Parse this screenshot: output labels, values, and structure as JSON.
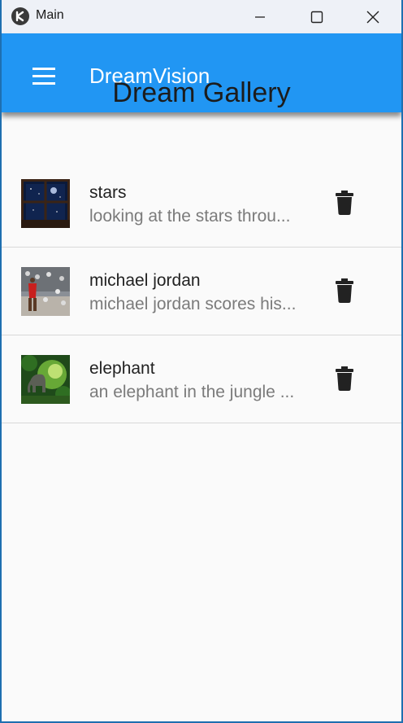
{
  "window": {
    "title": "Main",
    "icons": {
      "app": "kivy-logo-icon",
      "minimize": "minimize-icon",
      "maximize": "maximize-icon",
      "close": "close-icon"
    }
  },
  "appbar": {
    "menu_icon": "hamburger-menu-icon",
    "title": "DreamVision",
    "subtitle": "Dream Gallery",
    "color": "#2196f3"
  },
  "gallery": {
    "items": [
      {
        "title": "stars",
        "description": "looking at the stars throu...",
        "thumbnail": "window-night-sky-image",
        "action_icon": "trash-icon"
      },
      {
        "title": "michael jordan",
        "description": "michael jordan scores his...",
        "thumbnail": "basketball-player-image",
        "action_icon": "trash-icon"
      },
      {
        "title": "elephant",
        "description": "an elephant in the jungle ...",
        "thumbnail": "jungle-elephant-image",
        "action_icon": "trash-icon"
      }
    ]
  }
}
